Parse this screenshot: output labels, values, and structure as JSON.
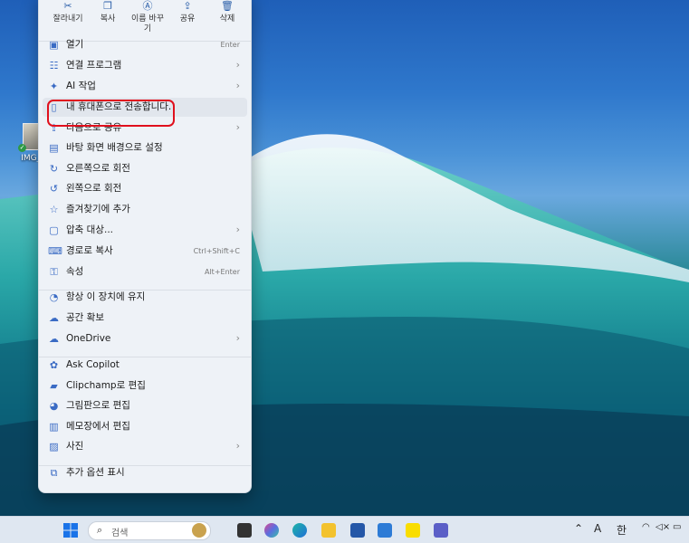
{
  "desktop": {
    "icon_label": "IMG_1"
  },
  "quick_actions": [
    {
      "icon": "scissors-icon",
      "glyph": "✂",
      "label": "잘라내기"
    },
    {
      "icon": "copy-icon",
      "glyph": "❐",
      "label": "복사"
    },
    {
      "icon": "rename-icon",
      "glyph": "Ⓐ",
      "label": "이름 바꾸\n기"
    },
    {
      "icon": "share-icon",
      "glyph": "⇪",
      "label": "공유"
    },
    {
      "icon": "trash-icon",
      "glyph": "🗑",
      "label": "삭제"
    }
  ],
  "menu_items": [
    {
      "icon": "open-icon",
      "glyph": "▣",
      "label": "열기",
      "shortcut": "Enter",
      "submenu": false
    },
    {
      "icon": "open-with-icon",
      "glyph": "☷",
      "label": "연결 프로그램",
      "shortcut": "",
      "submenu": true
    },
    {
      "icon": "ai-sparkle-icon",
      "glyph": "✦",
      "label": "AI 작업",
      "shortcut": "",
      "submenu": true
    },
    {
      "icon": "phone-icon",
      "glyph": "▯",
      "label": "내 휴대폰으로 전송합니다.",
      "shortcut": "",
      "submenu": false
    },
    {
      "icon": "share-icon",
      "glyph": "⇪",
      "label": "다음으로 공유",
      "shortcut": "",
      "submenu": true
    },
    {
      "icon": "wallpaper-icon",
      "glyph": "▤",
      "label": "바탕 화면 배경으로 설정",
      "shortcut": "",
      "submenu": false
    },
    {
      "icon": "rotate-right-icon",
      "glyph": "↻",
      "label": "오른쪽으로 회전",
      "shortcut": "",
      "submenu": false
    },
    {
      "icon": "rotate-left-icon",
      "glyph": "↺",
      "label": "왼쪽으로 회전",
      "shortcut": "",
      "submenu": false
    },
    {
      "icon": "star-icon",
      "glyph": "☆",
      "label": "즐겨찾기에 추가",
      "shortcut": "",
      "submenu": false
    },
    {
      "icon": "compress-icon",
      "glyph": "▢",
      "label": "압축 대상...",
      "shortcut": "",
      "submenu": true
    },
    {
      "icon": "copy-path-icon",
      "glyph": "⌨",
      "label": "경로로 복사",
      "shortcut": "Ctrl+Shift+C",
      "submenu": false
    },
    {
      "icon": "properties-icon",
      "glyph": "⚿",
      "label": "속성",
      "shortcut": "Alt+Enter",
      "submenu": false
    },
    {
      "icon": "keep-on-device-icon",
      "glyph": "◔",
      "label": "항상 이 장치에 유지",
      "shortcut": "",
      "submenu": false
    },
    {
      "icon": "cloud-outline-icon",
      "glyph": "☁",
      "label": "공간 확보",
      "shortcut": "",
      "submenu": false
    },
    {
      "icon": "onedrive-icon",
      "glyph": "☁",
      "label": "OneDrive",
      "shortcut": "",
      "submenu": true
    },
    {
      "icon": "copilot-icon",
      "glyph": "✿",
      "label": "Ask Copilot",
      "shortcut": "",
      "submenu": false
    },
    {
      "icon": "clipchamp-icon",
      "glyph": "▰",
      "label": "Clipchamp로 편집",
      "shortcut": "",
      "submenu": false
    },
    {
      "icon": "paint-icon",
      "glyph": "◕",
      "label": "그림판으로 편집",
      "shortcut": "",
      "submenu": false
    },
    {
      "icon": "notepad-icon",
      "glyph": "▥",
      "label": "메모장에서 편집",
      "shortcut": "",
      "submenu": false
    },
    {
      "icon": "photos-icon",
      "glyph": "▨",
      "label": "사진",
      "shortcut": "",
      "submenu": true
    },
    {
      "icon": "more-options-icon",
      "glyph": "⧉",
      "label": "추가 옵션 표시",
      "shortcut": "",
      "submenu": false
    }
  ],
  "taskbar": {
    "search_placeholder": "검색",
    "tray_input_a": "A",
    "tray_input_han": "한"
  },
  "colors": {
    "highlight_border": "#e0101d",
    "accent": "#3a6bc4"
  }
}
